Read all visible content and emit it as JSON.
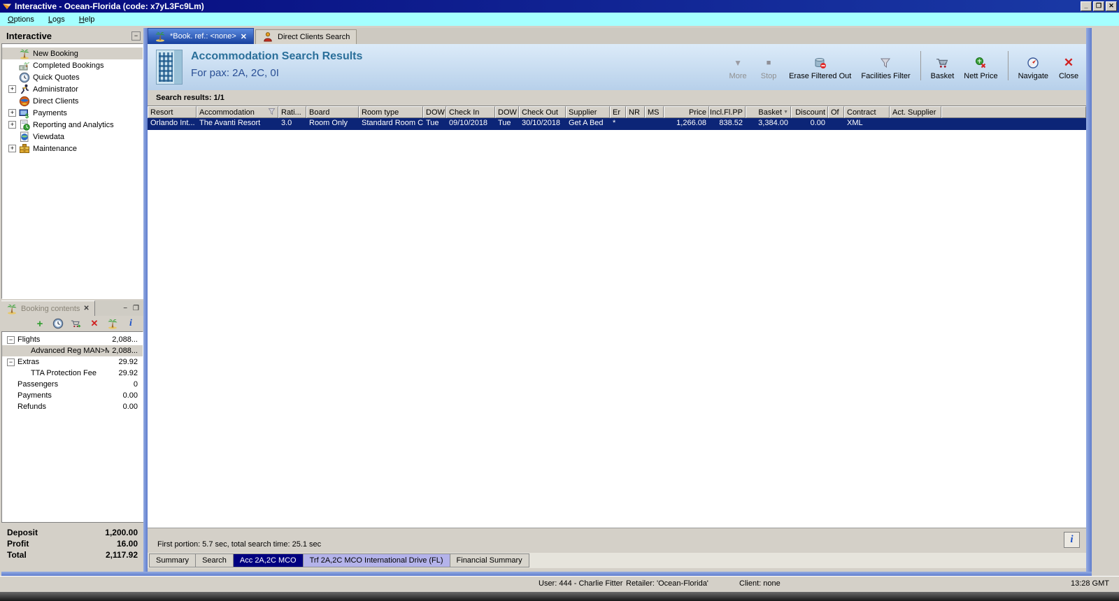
{
  "window": {
    "title": "Interactive - Ocean-Florida (code: x7yL3Fc9Lm)"
  },
  "icons": {
    "minimize": "_",
    "maximize": "❐",
    "close": "✕",
    "collapse": "−",
    "expander_plus": "+",
    "expander_minus": "−",
    "info": "i",
    "sort_desc": "▼",
    "more_arrow": "▼",
    "stop_square": "■",
    "add_plus": "+"
  },
  "menu": {
    "items": [
      {
        "label": "Options"
      },
      {
        "label": "Logs"
      },
      {
        "label": "Help"
      }
    ]
  },
  "sidebar": {
    "title": "Interactive",
    "items": [
      {
        "label": "New Booking",
        "icon": "palm-tree-icon",
        "selected": true
      },
      {
        "label": "Completed Bookings",
        "icon": "money-palm-icon"
      },
      {
        "label": "Quick Quotes",
        "icon": "clock-globe-icon"
      },
      {
        "label": "Administrator",
        "icon": "runner-icon",
        "expandable": true
      },
      {
        "label": "Direct Clients",
        "icon": "red-globe-icon"
      },
      {
        "label": "Payments",
        "icon": "payments-icon",
        "expandable": true
      },
      {
        "label": "Reporting and Analytics",
        "icon": "report-icon",
        "expandable": true
      },
      {
        "label": "Viewdata",
        "icon": "viewdata-icon"
      },
      {
        "label": "Maintenance",
        "icon": "maintenance-icon",
        "expandable": true
      }
    ]
  },
  "booking": {
    "title": "Booking contents",
    "rows": [
      {
        "label": "Flights",
        "value": "2,088..."
      },
      {
        "label": "Advanced Reg MAN>M",
        "value": "2,088...",
        "selected": true
      },
      {
        "label": "Extras",
        "value": "29.92"
      },
      {
        "label": "TTA Protection Fee",
        "value": "29.92"
      },
      {
        "label": "Passengers",
        "value": "0"
      },
      {
        "label": "Payments",
        "value": "0.00"
      },
      {
        "label": "Refunds",
        "value": "0.00"
      }
    ],
    "summary": [
      {
        "label": "Deposit",
        "value": "1,200.00"
      },
      {
        "label": "Profit",
        "value": "16.00"
      },
      {
        "label": "Total",
        "value": "2,117.92"
      }
    ]
  },
  "main": {
    "tabs": [
      {
        "label": "*Book. ref.: <none>",
        "active": true
      },
      {
        "label": "Direct Clients Search",
        "active": false
      }
    ],
    "header": {
      "title": "Accommodation Search Results",
      "subtitle": "For pax: 2A, 2C, 0I"
    },
    "toolbar": [
      {
        "label": "More",
        "disabled": true
      },
      {
        "label": "Stop",
        "disabled": true
      },
      {
        "label": "Erase Filtered Out"
      },
      {
        "label": "Facilities Filter"
      },
      {
        "label": "Basket"
      },
      {
        "label": "Nett Price"
      },
      {
        "label": "Navigate"
      },
      {
        "label": "Close"
      }
    ],
    "results_summary": "Search results: 1/1",
    "table": {
      "columns": [
        "Resort",
        "Accommodation",
        "Rati...",
        "Board",
        "Room type",
        "DOW",
        "Check In",
        "DOW",
        "Check Out",
        "Supplier",
        "Er",
        "NR",
        "MS",
        "Price",
        "Incl.Fl.PP",
        "Basket",
        "Discount",
        "Of",
        "Contract",
        "Act. Supplier"
      ],
      "row": [
        "Orlando Int...",
        "The Avanti Resort",
        "3.0",
        "Room Only",
        "Standard Room C",
        "Tue",
        "09/10/2018",
        "Tue",
        "30/10/2018",
        "Get A Bed",
        "*",
        "",
        "",
        "1,266.08",
        "838.52",
        "3,384.00",
        "0.00",
        "",
        "XML",
        ""
      ]
    },
    "status_text": "First portion: 5.7 sec, total search time: 25.1 sec",
    "bottom_tabs": [
      {
        "label": "Summary"
      },
      {
        "label": "Search"
      },
      {
        "label": "Acc 2A,2C MCO",
        "active": true
      },
      {
        "label": "Trf 2A,2C MCO International Drive (FL)",
        "highlight": true
      },
      {
        "label": "Financial Summary"
      }
    ]
  },
  "statusbar": {
    "user": "User: 444 - Charlie Fitter",
    "retailer": "Retailer: 'Ocean-Florida'",
    "client": "Client: none",
    "time": "13:28 GMT"
  },
  "colors": {
    "title_navy": "#0a1a90",
    "menu_cyan": "#a4ffff",
    "selection_navy": "#0c2577",
    "active_tab_navy": "#000080",
    "lavender_tab": "#b4b3ea",
    "header_blue_top": "#dcebf9",
    "header_blue_bottom": "#b7d0ea"
  }
}
